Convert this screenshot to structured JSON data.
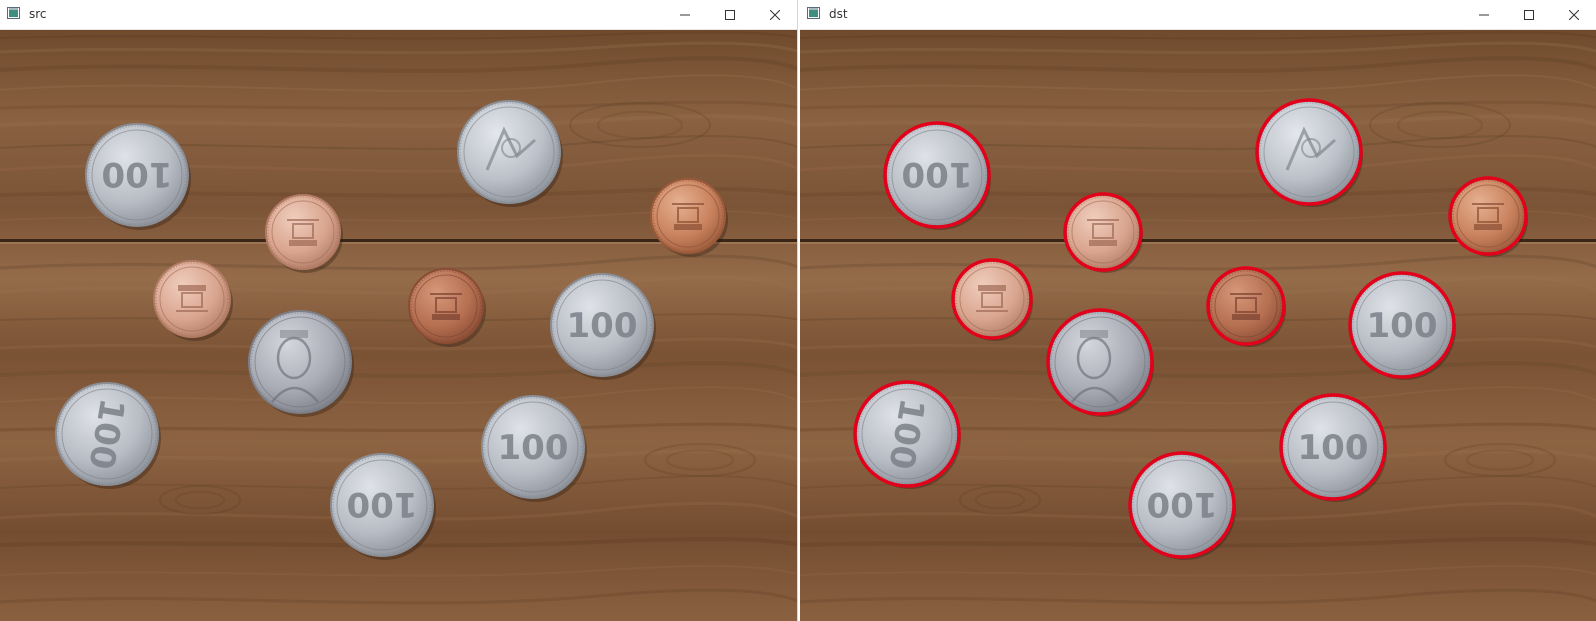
{
  "windows": [
    {
      "title": "src",
      "icon": "opencv-window-icon",
      "controls": [
        "minimize-icon",
        "maximize-icon",
        "close-icon"
      ]
    },
    {
      "title": "dst",
      "icon": "opencv-window-icon",
      "controls": [
        "minimize-icon",
        "maximize-icon",
        "close-icon"
      ]
    }
  ],
  "coins": [
    {
      "label": "100"
    },
    {
      "label": "100"
    },
    {
      "label": "100"
    },
    {
      "label": "100"
    },
    {
      "label": "100"
    },
    {
      "label": "100"
    },
    {
      "label": "100"
    },
    {
      "label": "10"
    },
    {
      "label": "10"
    },
    {
      "label": "10"
    },
    {
      "label": "10"
    }
  ],
  "detection_color": "#e3001b"
}
